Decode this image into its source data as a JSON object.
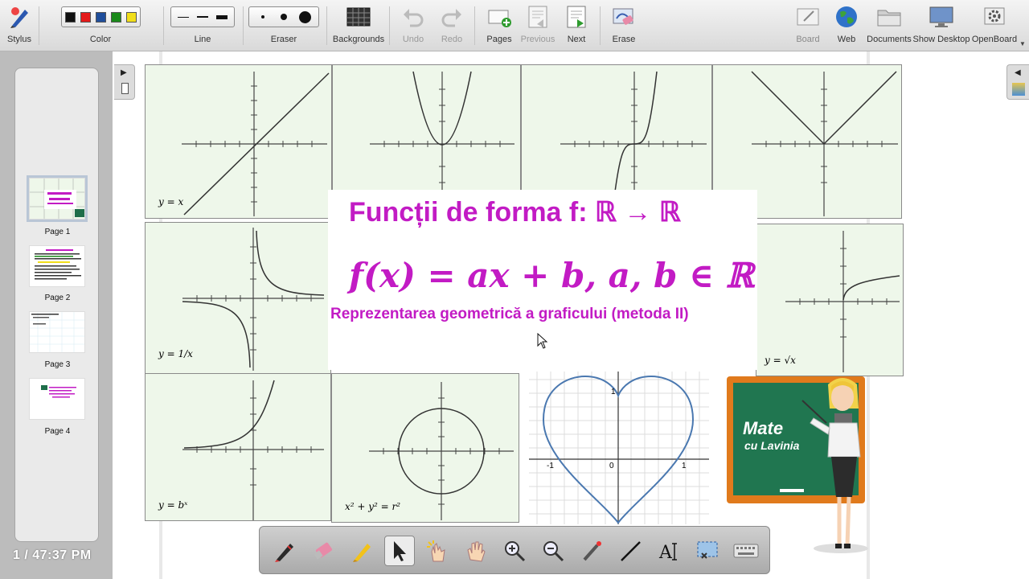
{
  "toolbar": {
    "stylus": "Stylus",
    "color": "Color",
    "line": "Line",
    "eraser": "Eraser",
    "backgrounds": "Backgrounds",
    "undo": "Undo",
    "redo": "Redo",
    "pages": "Pages",
    "previous": "Previous",
    "next": "Next",
    "erase": "Erase",
    "board": "Board",
    "web": "Web",
    "documents": "Documents",
    "show_desktop": "Show Desktop",
    "openboard": "OpenBoard",
    "colors": [
      "#111111",
      "#e41a1a",
      "#1f4e9b",
      "#1b8a1b",
      "#f1de1a"
    ]
  },
  "sidebar": {
    "pages": [
      {
        "label": "Page 1",
        "selected": true
      },
      {
        "label": "Page 2",
        "selected": false
      },
      {
        "label": "Page 3",
        "selected": false
      },
      {
        "label": "Page 4",
        "selected": false
      }
    ],
    "status": "1 / 47:37 PM"
  },
  "board": {
    "title": "Funcții de forma f: ℝ → ℝ",
    "formula": "f(x) = ax + b, a, b ∈ ℝ",
    "subtitle": "Reprezentarea geometrică a graficului (metoda II)",
    "graph_labels": {
      "g1": "y = x",
      "g5": "y = 1/x",
      "g6": "y = √x",
      "g7": "y = bˣ",
      "g8": "x² + y² = r²",
      "heart_neg1": "-1",
      "heart_zero": "0",
      "heart_pos1": "1",
      "heart_top1": "1"
    },
    "chalkboard_line1": "Mate",
    "chalkboard_line2": "cu Lavinia",
    "accent_color": "#c21bc4"
  },
  "bottom_tools": [
    "pen-icon",
    "eraser-icon",
    "highlighter-icon",
    "select-arrow-icon",
    "interact-hand-icon",
    "pan-hand-icon",
    "zoom-in-icon",
    "zoom-out-icon",
    "laser-pointer-icon",
    "line-icon",
    "text-icon",
    "capture-icon",
    "keyboard-icon"
  ]
}
